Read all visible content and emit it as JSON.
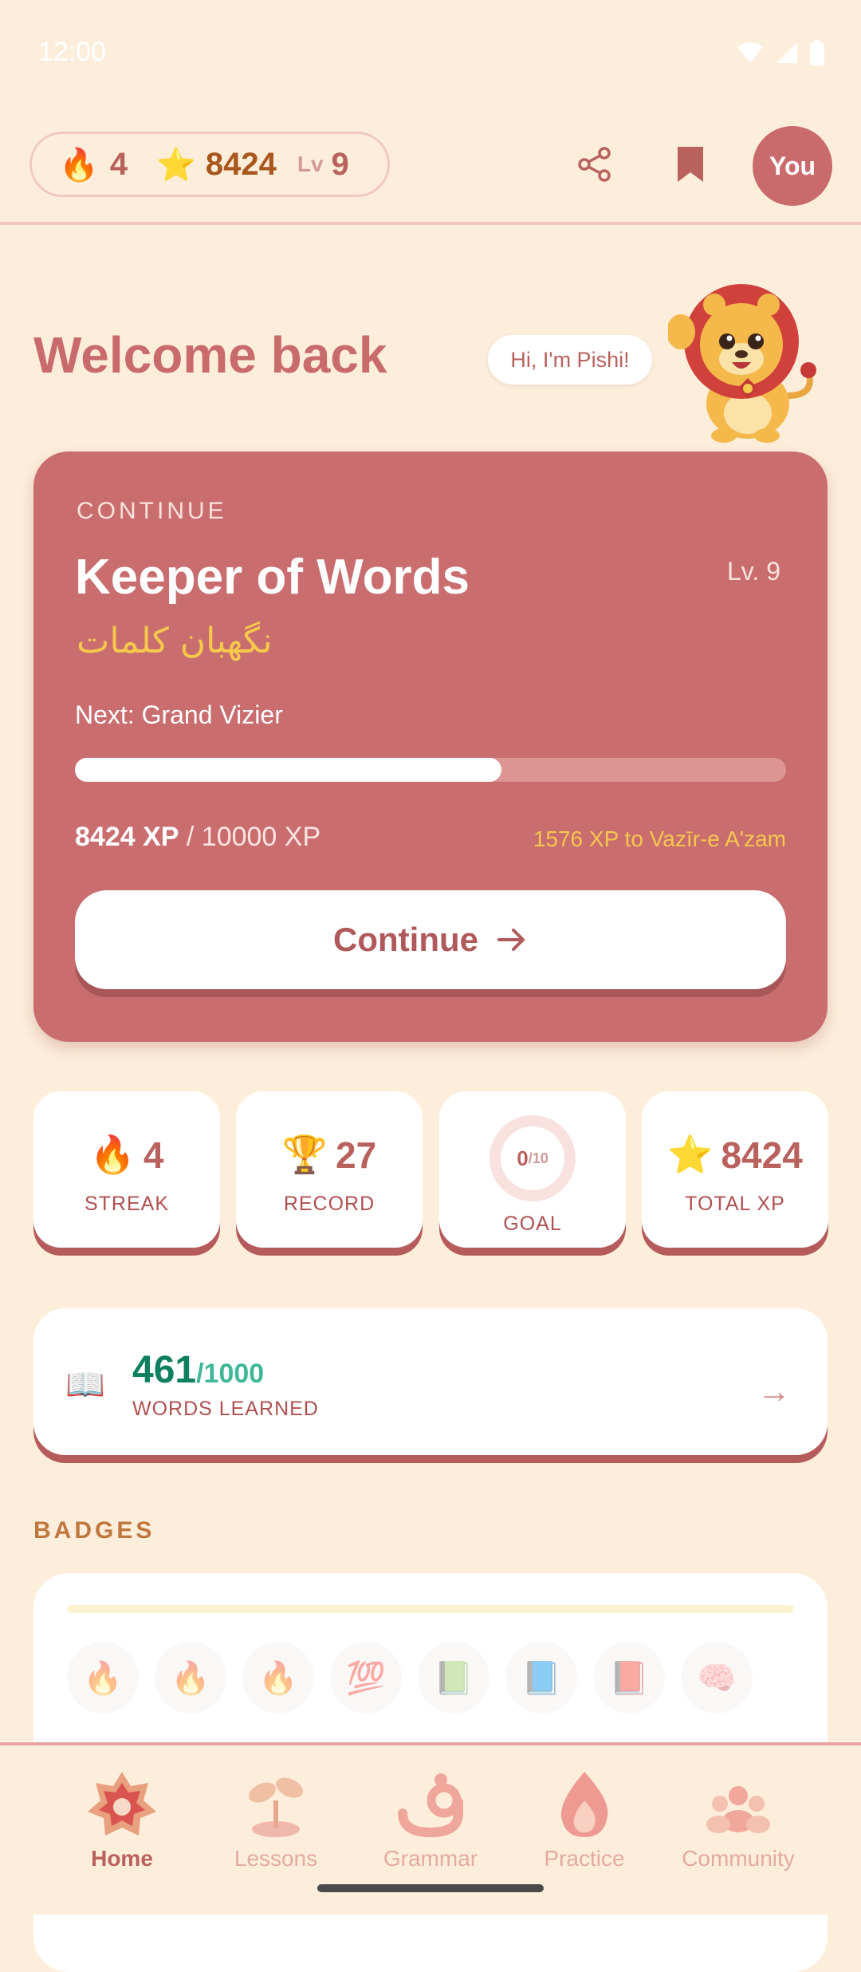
{
  "status_bar": {
    "time": "12:00"
  },
  "top_bar": {
    "streak": "4",
    "xp": "8424",
    "level_label": "Lv",
    "level": "9",
    "avatar_label": "You"
  },
  "welcome": {
    "title": "Welcome back",
    "mascot_greeting": "Hi, I'm Pishi!"
  },
  "continue_card": {
    "eyebrow": "CONTINUE",
    "title": "Keeper of Words",
    "level": "Lv. 9",
    "persian_title": "نگهبان کلمات",
    "next": "Next: Grand Vizier",
    "progress": 0.6,
    "xp_current": "8424 XP",
    "xp_total": " / 10000 XP",
    "xp_to_next": "1576 XP to Vazīr-e A'zam",
    "button_label": "Continue"
  },
  "stats": {
    "streak": {
      "value": "4",
      "label": "STREAK"
    },
    "record": {
      "value": "27",
      "label": "RECORD"
    },
    "goal": {
      "value": "0",
      "total": "/10",
      "label": "GOAL",
      "progress": 0
    },
    "total_xp": {
      "value": "8424",
      "label": "TOTAL XP"
    }
  },
  "words": {
    "learned": "461",
    "total": "/1000",
    "label": "WORDS LEARNED"
  },
  "badges": {
    "title": "BADGES",
    "row1": [
      "🔥",
      "🔥",
      "🔥",
      "💯",
      "📗",
      "📘",
      "📕",
      "🧠"
    ]
  },
  "nav": {
    "items": [
      {
        "label": "Home",
        "icon": "home-star-icon",
        "active": true
      },
      {
        "label": "Lessons",
        "icon": "sprout-icon",
        "active": false
      },
      {
        "label": "Grammar",
        "icon": "persian-letter-icon",
        "active": false
      },
      {
        "label": "Practice",
        "icon": "flame-icon",
        "active": false
      },
      {
        "label": "Community",
        "icon": "people-icon",
        "active": false
      }
    ]
  },
  "colors": {
    "background": "#fdeedb",
    "accent": "#c96a6c",
    "card": "#c96d6f",
    "gold": "#f6c84c",
    "green": "#0e8060"
  }
}
